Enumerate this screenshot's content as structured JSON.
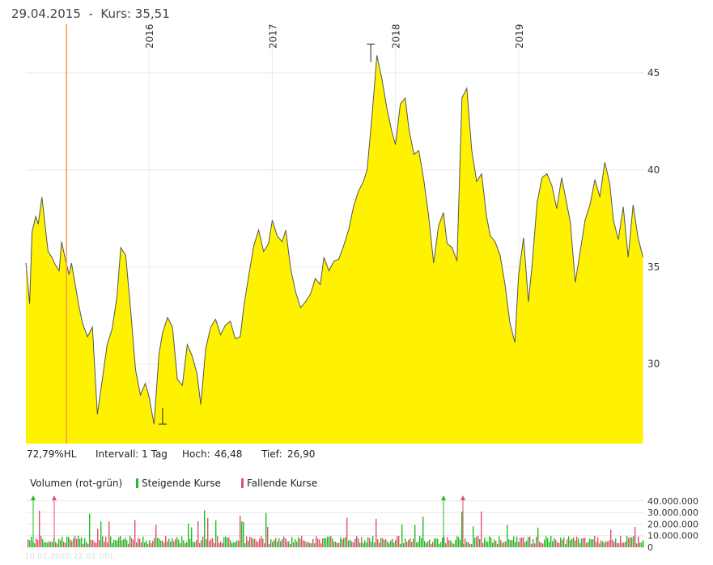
{
  "header": {
    "date": "29.04.2015",
    "separator": "-",
    "price_label": "Kurs: 35,51"
  },
  "stats": {
    "performance": "72,79%HL",
    "interval": "Intervall: 1 Tag",
    "high_label": "Hoch:",
    "high_value": "46,48",
    "low_label": "Tief:",
    "low_value": "26,90"
  },
  "volume_legend": {
    "title": "Volumen (rot-grün)",
    "rising": "Steigende Kurse",
    "falling": "Fallende Kurse"
  },
  "footer": "10.01.2020 22:01 Uhr",
  "colors": {
    "area_fill": "#fff200",
    "line": "#555555",
    "grid": "#e8e8e8",
    "marker": "#ff9a3c",
    "rising": "#22bb22",
    "falling": "#e0506a"
  },
  "chart_data": [
    {
      "type": "area",
      "name_hidden": "",
      "x_tick_labels": [
        "2016",
        "2017",
        "2018",
        "2019"
      ],
      "x_ticks": [
        2016.0,
        2017.0,
        2018.0,
        2019.0
      ],
      "xlim": [
        2015.0,
        2020.02
      ],
      "ylim": [
        25.9,
        47.5
      ],
      "y_ticks": [
        30,
        35,
        40,
        45
      ],
      "y_tick_labels": [
        "30",
        "35",
        "40",
        "45"
      ],
      "grid": true,
      "marker_x": 2015.33,
      "high": {
        "x": 2017.8,
        "y": 46.48
      },
      "low": {
        "x": 2016.11,
        "y": 26.9
      },
      "x": [
        2015.0,
        2015.03,
        2015.05,
        2015.08,
        2015.1,
        2015.13,
        2015.16,
        2015.18,
        2015.21,
        2015.24,
        2015.27,
        2015.29,
        2015.32,
        2015.35,
        2015.37,
        2015.4,
        2015.43,
        2015.46,
        2015.5,
        2015.54,
        2015.58,
        2015.62,
        2015.66,
        2015.7,
        2015.74,
        2015.77,
        2015.81,
        2015.85,
        2015.89,
        2015.93,
        2015.97,
        2016.0,
        2016.04,
        2016.08,
        2016.11,
        2016.15,
        2016.19,
        2016.23,
        2016.27,
        2016.31,
        2016.35,
        2016.39,
        2016.42,
        2016.46,
        2016.5,
        2016.54,
        2016.58,
        2016.62,
        2016.66,
        2016.7,
        2016.74,
        2016.77,
        2016.81,
        2016.85,
        2016.89,
        2016.93,
        2016.97,
        2017.0,
        2017.04,
        2017.08,
        2017.11,
        2017.15,
        2017.19,
        2017.23,
        2017.27,
        2017.31,
        2017.35,
        2017.39,
        2017.42,
        2017.46,
        2017.5,
        2017.54,
        2017.58,
        2017.62,
        2017.66,
        2017.7,
        2017.74,
        2017.77,
        2017.81,
        2017.85,
        2017.89,
        2017.93,
        2017.97,
        2018.0,
        2018.04,
        2018.08,
        2018.11,
        2018.15,
        2018.19,
        2018.23,
        2018.27,
        2018.31,
        2018.35,
        2018.39,
        2018.42,
        2018.46,
        2018.5,
        2018.54,
        2018.58,
        2018.62,
        2018.66,
        2018.7,
        2018.74,
        2018.77,
        2018.81,
        2018.85,
        2018.89,
        2018.93,
        2018.97,
        2019.0,
        2019.04,
        2019.08,
        2019.11,
        2019.15,
        2019.19,
        2019.23,
        2019.27,
        2019.31,
        2019.35,
        2019.39,
        2019.42,
        2019.46,
        2019.5,
        2019.54,
        2019.58,
        2019.62,
        2019.66,
        2019.7,
        2019.74,
        2019.77,
        2019.81,
        2019.85,
        2019.89,
        2019.93,
        2019.97,
        2020.01
      ],
      "y": [
        35.2,
        33.1,
        36.8,
        37.6,
        37.2,
        38.6,
        36.9,
        35.8,
        35.5,
        35.1,
        34.8,
        36.3,
        35.4,
        34.6,
        35.2,
        34.1,
        33.0,
        32.1,
        31.4,
        31.9,
        27.4,
        29.2,
        31.0,
        31.8,
        33.5,
        36.0,
        35.6,
        32.8,
        29.7,
        28.4,
        29.0,
        28.3,
        26.9,
        30.5,
        31.6,
        32.4,
        31.9,
        29.2,
        28.9,
        31.0,
        30.4,
        29.5,
        27.9,
        30.8,
        31.9,
        32.3,
        31.5,
        32.0,
        32.2,
        31.3,
        31.4,
        33.0,
        34.6,
        36.1,
        36.9,
        35.8,
        36.2,
        37.4,
        36.6,
        36.3,
        36.9,
        34.9,
        33.7,
        32.9,
        33.2,
        33.6,
        34.4,
        34.1,
        35.5,
        34.8,
        35.3,
        35.4,
        36.1,
        36.9,
        38.1,
        38.9,
        39.4,
        40.0,
        42.8,
        45.9,
        44.7,
        43.2,
        42.0,
        41.3,
        43.4,
        43.7,
        42.1,
        40.8,
        41.0,
        39.5,
        37.6,
        35.2,
        37.1,
        37.8,
        36.2,
        36.0,
        35.3,
        43.7,
        44.2,
        41.0,
        39.4,
        39.8,
        37.6,
        36.6,
        36.3,
        35.6,
        34.1,
        32.1,
        31.1,
        34.6,
        36.5,
        33.2,
        35.1,
        38.3,
        39.6,
        39.8,
        39.2,
        38.0,
        39.6,
        38.3,
        37.3,
        34.2,
        35.8,
        37.4,
        38.2,
        39.5,
        38.6,
        40.4,
        39.3,
        37.4,
        36.4,
        38.1,
        35.5,
        38.2,
        36.5,
        35.5
      ]
    },
    {
      "type": "bar",
      "y_ticks": [
        0,
        10000000,
        20000000,
        30000000,
        40000000
      ],
      "y_tick_labels": [
        "0",
        "10.000.000",
        "20.000.000",
        "30.000.000",
        "40.000.000"
      ],
      "ylim": [
        0,
        42000000
      ],
      "typical_volume": 8000000
    }
  ]
}
